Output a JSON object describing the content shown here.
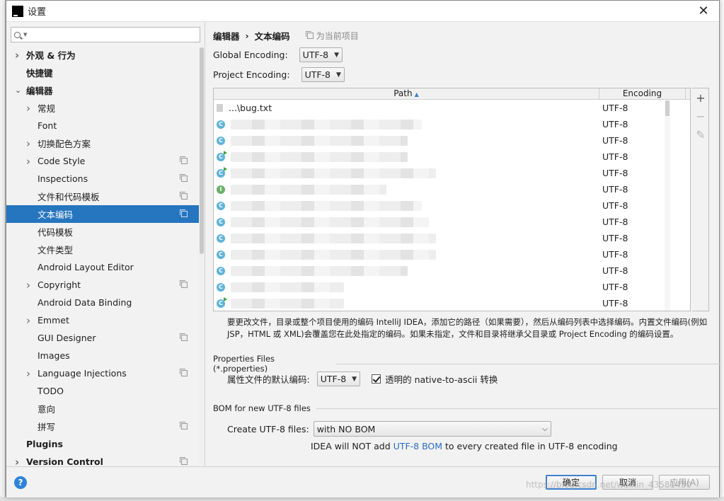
{
  "window": {
    "title": "设置"
  },
  "search": {
    "placeholder": ""
  },
  "sidebar": {
    "items": [
      {
        "label": "外观 & 行为",
        "level": 0,
        "arrow": "right",
        "bold": true,
        "copy": false
      },
      {
        "label": "快捷键",
        "level": 0,
        "arrow": "",
        "bold": true,
        "copy": false
      },
      {
        "label": "编辑器",
        "level": 0,
        "arrow": "down",
        "bold": true,
        "copy": false
      },
      {
        "label": "常规",
        "level": 1,
        "arrow": "right",
        "bold": false,
        "copy": false
      },
      {
        "label": "Font",
        "level": 1,
        "arrow": "",
        "bold": false,
        "copy": false
      },
      {
        "label": "切换配色方案",
        "level": 1,
        "arrow": "right",
        "bold": false,
        "copy": false
      },
      {
        "label": "Code Style",
        "level": 1,
        "arrow": "right",
        "bold": false,
        "copy": true
      },
      {
        "label": "Inspections",
        "level": 1,
        "arrow": "",
        "bold": false,
        "copy": true
      },
      {
        "label": "文件和代码模板",
        "level": 1,
        "arrow": "",
        "bold": false,
        "copy": true
      },
      {
        "label": "文本编码",
        "level": 1,
        "arrow": "",
        "bold": false,
        "copy": true,
        "selected": true
      },
      {
        "label": "代码模板",
        "level": 1,
        "arrow": "",
        "bold": false,
        "copy": false
      },
      {
        "label": "文件类型",
        "level": 1,
        "arrow": "",
        "bold": false,
        "copy": false
      },
      {
        "label": "Android Layout Editor",
        "level": 1,
        "arrow": "",
        "bold": false,
        "copy": false
      },
      {
        "label": "Copyright",
        "level": 1,
        "arrow": "right",
        "bold": false,
        "copy": true
      },
      {
        "label": "Android Data Binding",
        "level": 1,
        "arrow": "",
        "bold": false,
        "copy": false
      },
      {
        "label": "Emmet",
        "level": 1,
        "arrow": "right",
        "bold": false,
        "copy": false
      },
      {
        "label": "GUI Designer",
        "level": 1,
        "arrow": "",
        "bold": false,
        "copy": true
      },
      {
        "label": "Images",
        "level": 1,
        "arrow": "",
        "bold": false,
        "copy": false
      },
      {
        "label": "Language Injections",
        "level": 1,
        "arrow": "right",
        "bold": false,
        "copy": true
      },
      {
        "label": "TODO",
        "level": 1,
        "arrow": "",
        "bold": false,
        "copy": false
      },
      {
        "label": "意向",
        "level": 1,
        "arrow": "",
        "bold": false,
        "copy": false
      },
      {
        "label": "拼写",
        "level": 1,
        "arrow": "",
        "bold": false,
        "copy": true
      },
      {
        "label": "Plugins",
        "level": 0,
        "arrow": "",
        "bold": true,
        "copy": false
      },
      {
        "label": "Version Control",
        "level": 0,
        "arrow": "right",
        "bold": true,
        "copy": true
      }
    ]
  },
  "breadcrumb": {
    "parent": "编辑器",
    "separator": "›",
    "current": "文本编码",
    "scope": "为当前项目"
  },
  "global_encoding": {
    "label": "Global Encoding:",
    "value": "UTF-8"
  },
  "project_encoding": {
    "label": "Project Encoding:",
    "value": "UTF-8"
  },
  "table": {
    "col_path": "Path",
    "col_encoding": "Encoding",
    "rows": [
      {
        "icon": "txt",
        "path": "...\\bug.txt",
        "encoding": "UTF-8"
      },
      {
        "icon": "c",
        "path": "",
        "encoding": "UTF-8"
      },
      {
        "icon": "c",
        "path": "",
        "encoding": "UTF-8"
      },
      {
        "icon": "c-run",
        "path": "",
        "encoding": "UTF-8"
      },
      {
        "icon": "c-run",
        "path": "",
        "encoding": "UTF-8"
      },
      {
        "icon": "i",
        "path": "",
        "encoding": "UTF-8"
      },
      {
        "icon": "c",
        "path": "",
        "encoding": "UTF-8"
      },
      {
        "icon": "c",
        "path": "",
        "encoding": "UTF-8"
      },
      {
        "icon": "c",
        "path": "",
        "encoding": "UTF-8"
      },
      {
        "icon": "c",
        "path": "",
        "encoding": "UTF-8"
      },
      {
        "icon": "c",
        "path": "",
        "encoding": "UTF-8"
      },
      {
        "icon": "c",
        "path": "",
        "encoding": "UTF-8"
      },
      {
        "icon": "c-run",
        "path": "",
        "encoding": "UTF-8"
      }
    ]
  },
  "tools": {
    "add": "+",
    "remove": "−",
    "edit": "✎"
  },
  "help_text": "要更改文件，目录或整个项目使用的编码 IntelliJ IDEA，添加它的路径（如果需要），然后从编码列表中选择编码。内置文件编码(例如 JSP，HTML 或 XML)会覆盖您在此处指定的编码。如果未指定，文件和目录将继承父目录或 Project Encoding 的编码设置。",
  "properties": {
    "section_title": "Properties Files (*.properties)",
    "default_label": "属性文件的默认编码:",
    "default_value": "UTF-8",
    "native_label": "透明的 native-to-ascii 转换"
  },
  "bom": {
    "section_title": "BOM for new UTF-8 files",
    "create_label": "Create UTF-8 files:",
    "create_value": "with NO BOM",
    "note_prefix": "IDEA will NOT add ",
    "note_link": "UTF-8 BOM",
    "note_suffix": " to every created file in UTF-8 encoding"
  },
  "buttons": {
    "help": "?",
    "ok": "确定",
    "cancel": "取消",
    "apply": "应用(A)"
  },
  "watermark": "https://blog.csdn.net/weixin_43581430"
}
